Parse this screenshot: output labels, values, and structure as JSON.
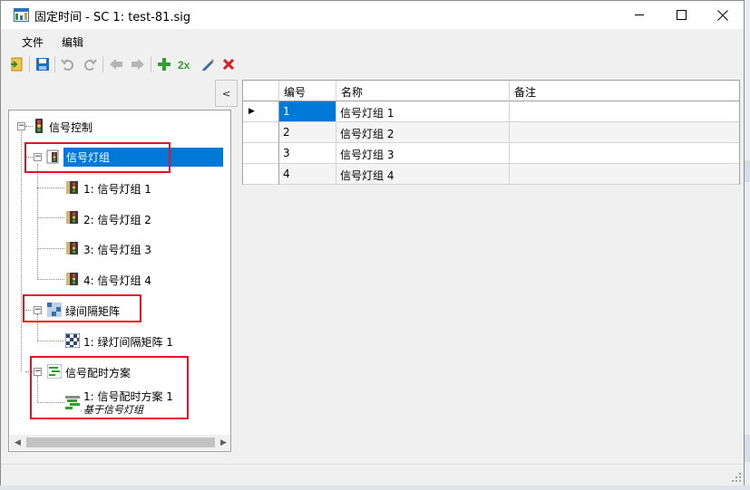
{
  "window": {
    "title": "固定时间 - SC 1: test-81.sig"
  },
  "menu": [
    "文件",
    "编辑"
  ],
  "toolbar": {
    "icons": [
      "exit-icon",
      "save-icon",
      "undo-icon",
      "redo-icon",
      "back-icon",
      "forward-icon",
      "add-icon",
      "duplicate-icon",
      "edit-icon",
      "delete-icon"
    ],
    "duplicate_label": "2x"
  },
  "left_panel": {
    "collapse_label": "<",
    "tree": {
      "root": "信号控制",
      "groups": [
        {
          "label": "信号灯组",
          "children": [
            "1: 信号灯组 1",
            "2: 信号灯组 2",
            "3: 信号灯组 3",
            "4: 信号灯组 4"
          ]
        },
        {
          "label": "绿间隔矩阵",
          "children": [
            "1: 绿灯间隔矩阵 1"
          ]
        },
        {
          "label": "信号配时方案",
          "children": [
            "1: 信号配时方案 1"
          ],
          "child_sub": "基于信号灯组"
        }
      ]
    }
  },
  "grid": {
    "columns": [
      "编号",
      "名称",
      "备注"
    ],
    "rows": [
      {
        "id": "1",
        "name": "信号灯组 1",
        "note": ""
      },
      {
        "id": "2",
        "name": "信号灯组 2",
        "note": ""
      },
      {
        "id": "3",
        "name": "信号灯组 3",
        "note": ""
      },
      {
        "id": "4",
        "name": "信号灯组 4",
        "note": ""
      }
    ],
    "row_pointer": "▶"
  },
  "colors": {
    "selection": "#0078d7",
    "highlight_box": "#e81224",
    "add_green": "#2ea02e",
    "delete_red": "#d81e1e",
    "save_blue": "#1e6fc8"
  }
}
